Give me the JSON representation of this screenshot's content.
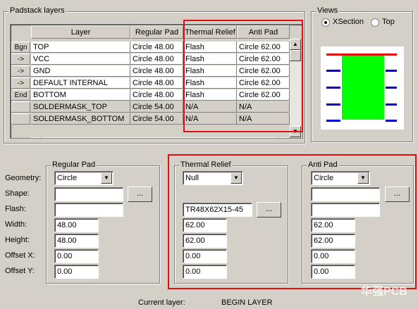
{
  "padstack_layers": {
    "title": "Padstack layers",
    "columns": [
      "Layer",
      "Regular Pad",
      "Thermal Relief",
      "Anti Pad"
    ],
    "rows": [
      {
        "btn": "Bgn",
        "layer": "TOP",
        "regular": "Circle 48.00",
        "thermal": "Flash",
        "anti": "Circle 62.00"
      },
      {
        "btn": "->",
        "layer": "VCC",
        "regular": "Circle 48.00",
        "thermal": "Flash",
        "anti": "Circle 62.00"
      },
      {
        "btn": "->",
        "layer": "GND",
        "regular": "Circle 48.00",
        "thermal": "Flash",
        "anti": "Circle 62.00"
      },
      {
        "btn": "->",
        "layer": "DEFAULT INTERNAL",
        "regular": "Circle 48.00",
        "thermal": "Flash",
        "anti": "Circle 62.00"
      },
      {
        "btn": "End",
        "layer": "BOTTOM",
        "regular": "Circle 48.00",
        "thermal": "Flash",
        "anti": "Circle 62.00"
      },
      {
        "btn": "",
        "layer": "SOLDERMASK_TOP",
        "regular": "Circle 54.00",
        "thermal": "N/A",
        "anti": "N/A"
      },
      {
        "btn": "",
        "layer": "SOLDERMASK_BOTTOM",
        "regular": "Circle 54.00",
        "thermal": "N/A",
        "anti": "N/A"
      }
    ]
  },
  "views": {
    "title": "Views",
    "options": [
      "XSection",
      "Top"
    ],
    "selected": "XSection"
  },
  "regular_pad": {
    "title": "Regular Pad",
    "geometry": "Circle",
    "shape": "",
    "flash": "",
    "width": "48.00",
    "height": "48.00",
    "offset_x": "0.00",
    "offset_y": "0.00"
  },
  "thermal_relief": {
    "title": "Thermal Relief",
    "geometry": "Null",
    "shape": "",
    "flash": "TR48X62X15-45",
    "width": "62.00",
    "height": "62.00",
    "offset_x": "0.00",
    "offset_y": "0.00"
  },
  "anti_pad": {
    "title": "Anti Pad",
    "geometry": "Circle",
    "shape": "",
    "flash": "",
    "width": "62.00",
    "height": "62.00",
    "offset_x": "0.00",
    "offset_y": "0.00"
  },
  "labels": {
    "geometry": "Geometry:",
    "shape": "Shape:",
    "flash": "Flash:",
    "width": "Width:",
    "height": "Height:",
    "offset_x": "Offset X:",
    "offset_y": "Offset Y:",
    "browse": "...",
    "current_layer": "Current layer:"
  },
  "current_layer_value": "BEGIN LAYER",
  "watermark": "华强PCB",
  "colors": {
    "highlight_box": "#e01010",
    "pad_fill": "#00ff00",
    "layer_top_bottom": "#e01010",
    "layer_inner": "#0000d0"
  }
}
